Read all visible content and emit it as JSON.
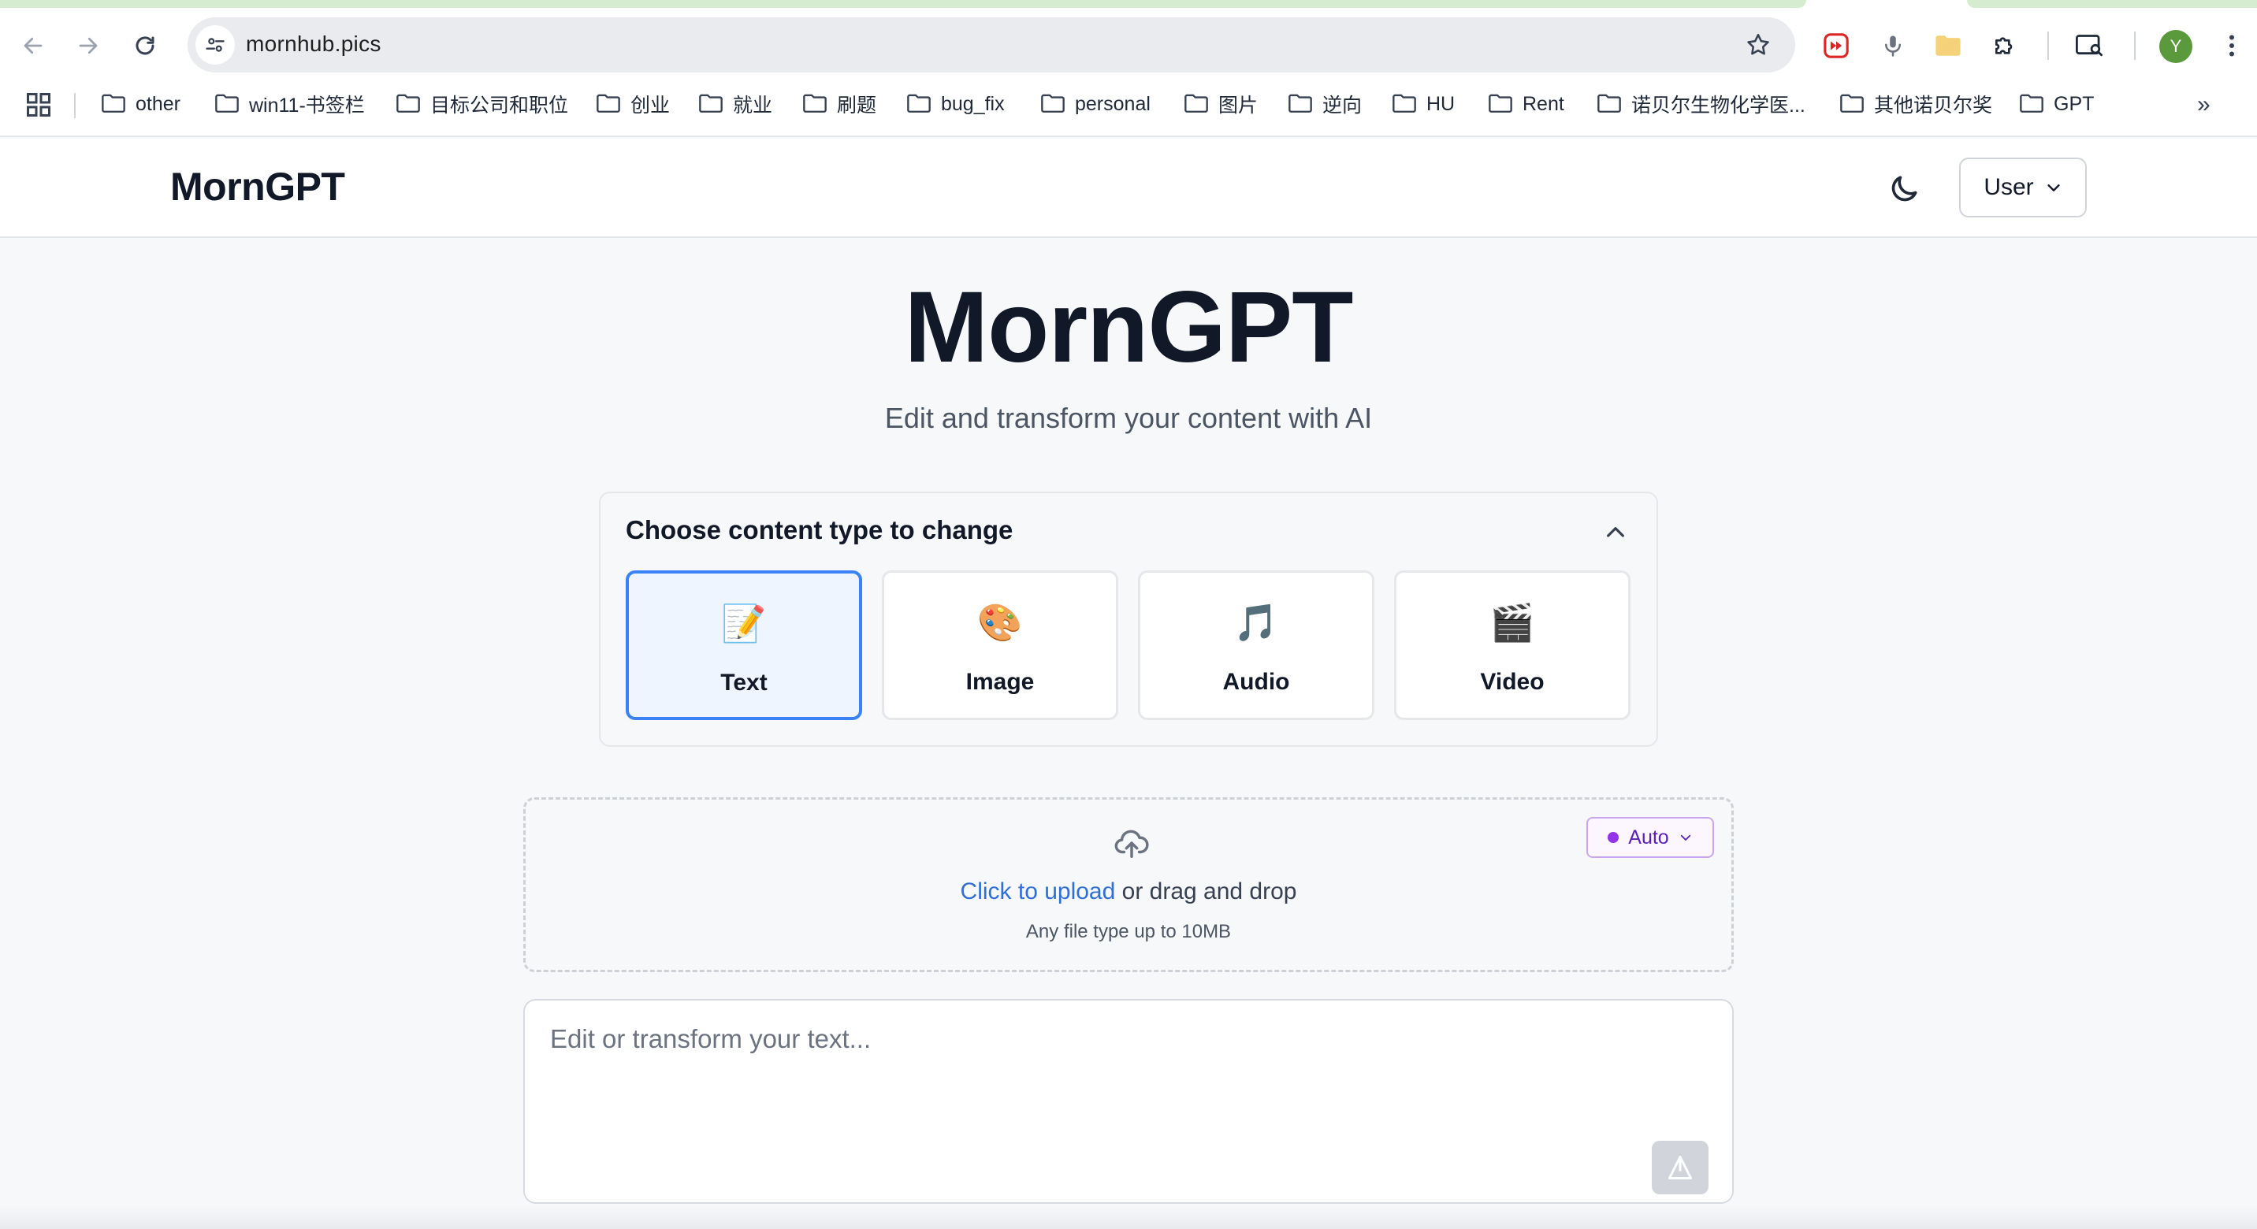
{
  "browser": {
    "url": "mornhub.pics",
    "profile_initial": "Y",
    "bookmarks": [
      {
        "label": "other"
      },
      {
        "label": "win11-书签栏"
      },
      {
        "label": "目标公司和职位"
      },
      {
        "label": "创业"
      },
      {
        "label": "就业"
      },
      {
        "label": "刷题"
      },
      {
        "label": "bug_fix"
      },
      {
        "label": "personal"
      },
      {
        "label": "图片"
      },
      {
        "label": "逆向"
      },
      {
        "label": "HU"
      },
      {
        "label": "Rent"
      },
      {
        "label": "诺贝尔生物化学医..."
      },
      {
        "label": "其他诺贝尔奖"
      },
      {
        "label": "GPT"
      }
    ],
    "overflow_label": "»"
  },
  "header": {
    "brand": "MornGPT",
    "user_label": "User"
  },
  "hero": {
    "title": "MornGPT",
    "subtitle": "Edit and transform your content with AI"
  },
  "content_type": {
    "title": "Choose content type to change",
    "selected": "Text",
    "options": [
      {
        "label": "Text",
        "emoji": "📝",
        "icon": "memo-icon"
      },
      {
        "label": "Image",
        "emoji": "🎨",
        "icon": "palette-icon"
      },
      {
        "label": "Audio",
        "emoji": "🎵",
        "icon": "music-note-icon"
      },
      {
        "label": "Video",
        "emoji": "🎬",
        "icon": "clapper-board-icon"
      }
    ]
  },
  "upload": {
    "link_text": "Click to upload",
    "rest_text": " or drag and drop",
    "hint": "Any file type up to 10MB",
    "mode_label": "Auto"
  },
  "editor": {
    "placeholder": "Edit or transform your text...",
    "value": ""
  },
  "colors": {
    "accent": "#3b82f6",
    "link": "#2f6fd6",
    "auto_dot": "#9333ea"
  }
}
